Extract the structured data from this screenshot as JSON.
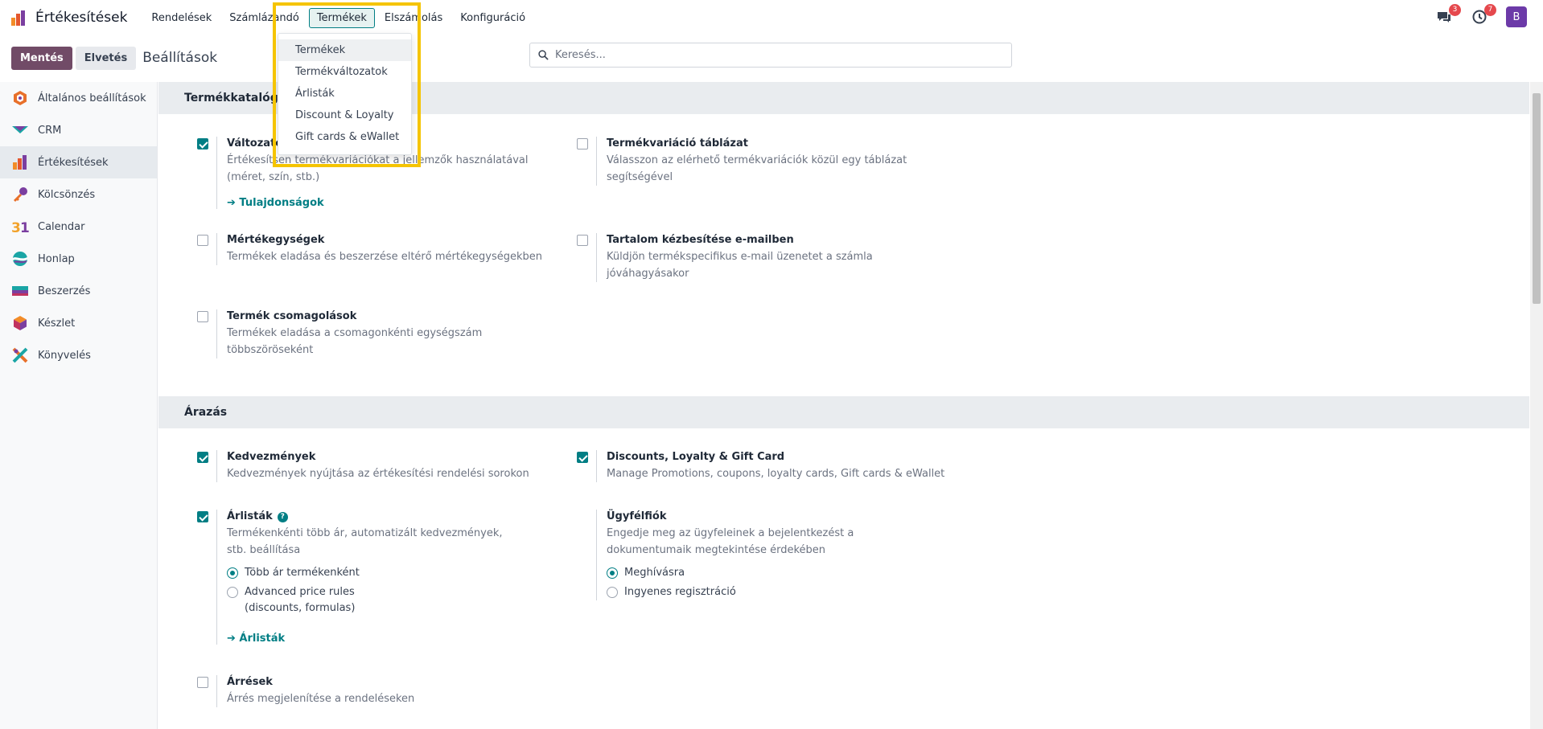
{
  "navbar": {
    "app_name": "Értékesítések",
    "menu": [
      "Rendelések",
      "Számlázandó",
      "Termékek",
      "Elszámolás",
      "Konfiguráció"
    ],
    "messages_count": "3",
    "activities_count": "7",
    "user_initial": "B"
  },
  "control": {
    "save_label": "Mentés",
    "discard_label": "Elvetés",
    "title": "Beállítások",
    "search_placeholder": "Keresés..."
  },
  "dropdown": {
    "items": [
      "Termékek",
      "Termékváltozatok",
      "Árlisták",
      "Discount & Loyalty",
      "Gift cards & eWallet"
    ]
  },
  "sidebar": {
    "items": [
      {
        "label": "Általános beállítások",
        "icon": "general-settings-icon"
      },
      {
        "label": "CRM",
        "icon": "crm-icon"
      },
      {
        "label": "Értékesítések",
        "icon": "sales-icon"
      },
      {
        "label": "Kölcsönzés",
        "icon": "rental-icon"
      },
      {
        "label": "Calendar",
        "icon": "calendar-icon"
      },
      {
        "label": "Honlap",
        "icon": "website-icon"
      },
      {
        "label": "Beszerzés",
        "icon": "purchase-icon"
      },
      {
        "label": "Készlet",
        "icon": "inventory-icon"
      },
      {
        "label": "Könyvelés",
        "icon": "accounting-icon"
      }
    ]
  },
  "catalog": {
    "heading": "Termékkatalógus",
    "variants": {
      "title": "Változatok",
      "desc": "Értékesítsen termékvariációkat a jellemzők használatával (méret, szín, stb.)",
      "link": "Tulajdonságok",
      "checked": true
    },
    "variant_grid": {
      "title": "Termékvariáció táblázat",
      "desc": "Válasszon az elérhető termékvariációk közül egy táblázat segítségével",
      "checked": false
    },
    "uom": {
      "title": "Mértékegységek",
      "desc": "Termékek eladása és beszerzése eltérő mértékegységekben",
      "checked": false
    },
    "email_delivery": {
      "title": "Tartalom kézbesítése e-mailben",
      "desc": "Küldjön termékspecifikus e-mail üzenetet a számla jóváhagyásakor",
      "checked": false
    },
    "packaging": {
      "title": "Termék csomagolások",
      "desc": "Termékek eladása a csomagonkénti egységszám többszöröseként",
      "checked": false
    }
  },
  "pricing": {
    "heading": "Árazás",
    "discounts": {
      "title": "Kedvezmények",
      "desc": "Kedvezmények nyújtása az értékesítési rendelési sorokon",
      "checked": true
    },
    "loyalty": {
      "title": "Discounts, Loyalty & Gift Card",
      "desc": "Manage Promotions, coupons, loyalty cards, Gift cards & eWallet",
      "checked": true
    },
    "pricelists": {
      "title": "Árlisták",
      "desc": "Termékenkénti több ár, automatizált kedvezmények, stb. beállítása",
      "checked": true,
      "options": [
        "Több ár termékenként",
        "Advanced price rules",
        "(discounts, formulas)"
      ],
      "selected": "Több ár termékenként",
      "link": "Árlisták"
    },
    "portal": {
      "title": "Ügyfélfiók",
      "desc": "Engedje meg az ügyfeleinek a bejelentkezést a dokumentumaik megtekintése érdekében",
      "options": [
        "Meghívásra",
        "Ingyenes regisztráció"
      ],
      "selected": "Meghívásra"
    },
    "margins": {
      "title": "Árrések",
      "desc": "Árrés megjelenítése a rendeléseken",
      "checked": false
    }
  }
}
